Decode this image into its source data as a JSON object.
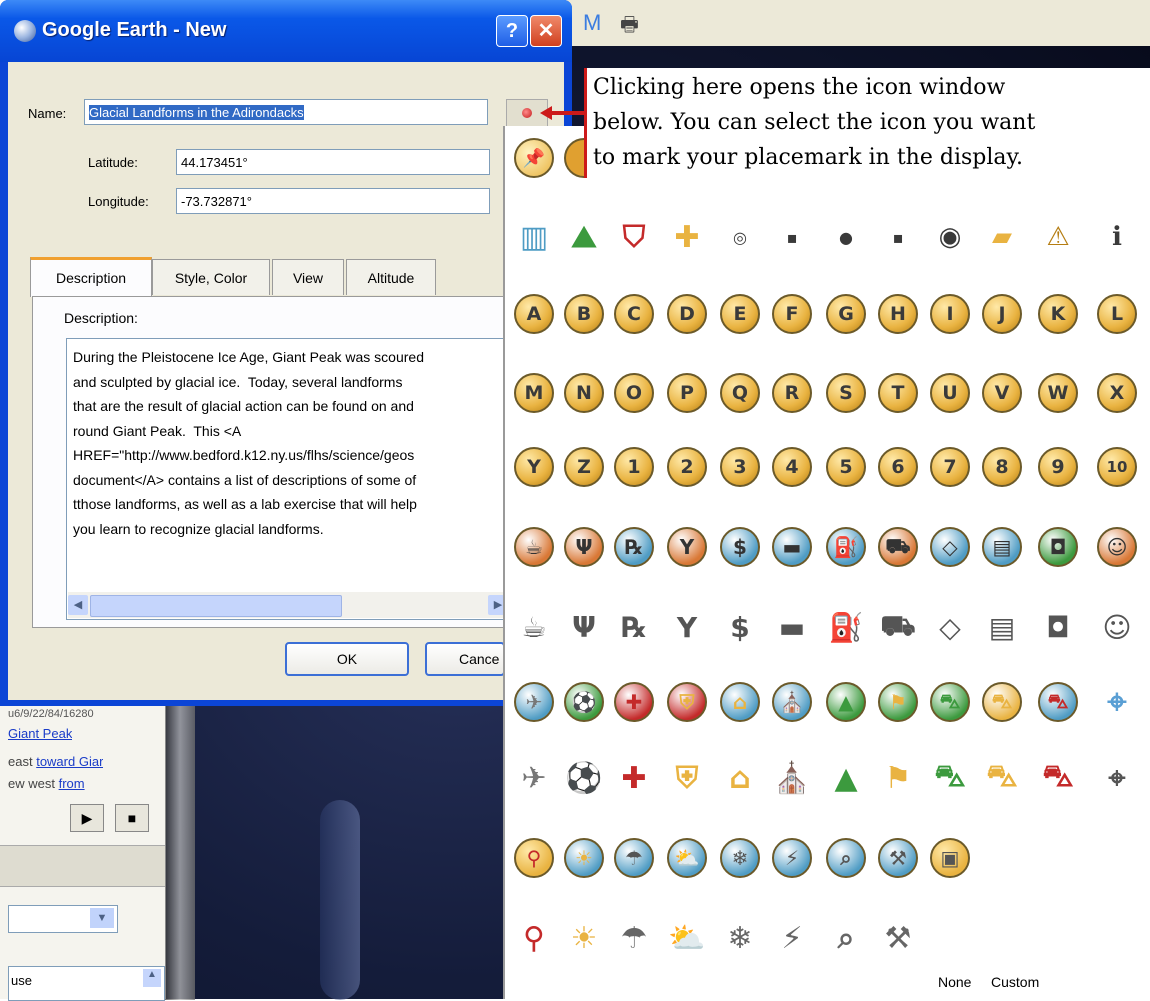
{
  "window": {
    "title": "Google Earth - New",
    "help_button": "?",
    "close_button": "✕"
  },
  "form": {
    "name_label": "Name:",
    "name_value": "Glacial Landforms in the Adirondacks",
    "latitude_label": "Latitude:",
    "latitude_value": "44.173451°",
    "longitude_label": "Longitude:",
    "longitude_value": "-73.732871°"
  },
  "tabs": [
    "Description",
    "Style, Color",
    "View",
    "Altitude"
  ],
  "description": {
    "label": "Description:",
    "lines": [
      "During the Pleistocene Ice Age, Giant Peak was scoured",
      "and sculpted by glacial ice.  Today, several landforms",
      "that are the result of glacial action can be found on and",
      "round Giant Peak.  This <A",
      "HREF=\"http://www.bedford.k12.ny.us/flhs/science/geos",
      "document</A> contains a list of descriptions of some of",
      "tthose landforms, as well as a lab exercise that will help",
      "you learn to recognize glacial landforms."
    ]
  },
  "buttons": {
    "ok": "OK",
    "cancel": "Cance"
  },
  "annotation": {
    "lines": [
      "Clicking here opens the icon window",
      "below.  You can select the icon you want",
      "to mark  your placemark in the display."
    ]
  },
  "background": {
    "menu_icons": [
      "gmail-icon",
      "print-icon"
    ],
    "left_panel": {
      "partial_code": "u6/9/22/84/16280",
      "link_giant_peak": "Giant Peak",
      "text_east": "east",
      "link_toward": "toward Giar",
      "text_west": "ew west",
      "link_from": "from",
      "list_item": "use"
    }
  },
  "picker": {
    "row1": [
      "pushpin",
      "pin",
      "pin",
      "pin",
      "pin",
      "pin",
      "pin",
      "pin",
      "pin",
      "pin",
      "pin",
      "pin"
    ],
    "row2": [
      "building",
      "mountains",
      "interstate-shield",
      "road-diamond",
      "target",
      "square-dot",
      "circle-dot",
      "square-dot-2",
      "globe-pin",
      "sticky-note",
      "warning",
      "info"
    ],
    "row3": [
      "A",
      "B",
      "C",
      "D",
      "E",
      "F",
      "G",
      "H",
      "I",
      "J",
      "K",
      "L"
    ],
    "row4": [
      "M",
      "N",
      "O",
      "P",
      "Q",
      "R",
      "S",
      "T",
      "U",
      "V",
      "W",
      "X"
    ],
    "row5": [
      "Y",
      "Z",
      "1",
      "2",
      "3",
      "4",
      "5",
      "6",
      "7",
      "8",
      "9",
      "10"
    ],
    "row6": [
      "coffee",
      "dining",
      "pharmacy",
      "bar",
      "bank",
      "lodging",
      "gas",
      "shopping",
      "convenience",
      "movies",
      "camera",
      "person"
    ],
    "row9": [
      "airport",
      "soccer",
      "hospital",
      "police",
      "home",
      "church",
      "park",
      "golf",
      "car",
      "taxi",
      "auto",
      "crosshair"
    ],
    "row11": [
      "temperature",
      "sun",
      "rain",
      "partly-cloudy",
      "snow",
      "thunder",
      "search-doc",
      "tools",
      "id-card"
    ],
    "none_label": "None",
    "custom_label": "Custom",
    "colors": {
      "gold": "#e9b341",
      "gold_dark": "#b57d12",
      "blue": "#4f9cc4",
      "orange": "#d97836",
      "green": "#3c9a3e",
      "red": "#c42a2a"
    }
  }
}
